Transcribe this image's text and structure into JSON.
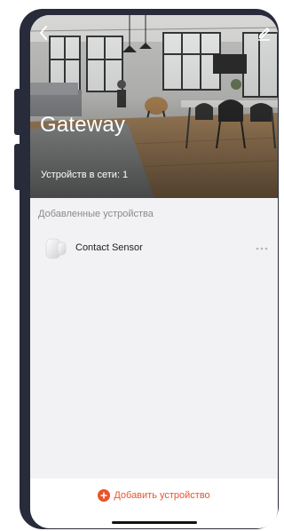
{
  "header": {
    "title": "Gateway",
    "status": "Устройств в сети: 1",
    "back_icon": "chevron-left-icon",
    "edit_icon": "pencil-icon"
  },
  "section": {
    "label": "Добавленные устройства"
  },
  "devices": [
    {
      "name": "Contact Sensor",
      "icon": "contact-sensor-icon"
    }
  ],
  "bottom": {
    "add_label": "Добавить устройство",
    "add_icon": "plus-circle-icon"
  },
  "colors": {
    "accent": "#e8542a",
    "frame": "#272b3a",
    "background": "#f2f2f4"
  }
}
